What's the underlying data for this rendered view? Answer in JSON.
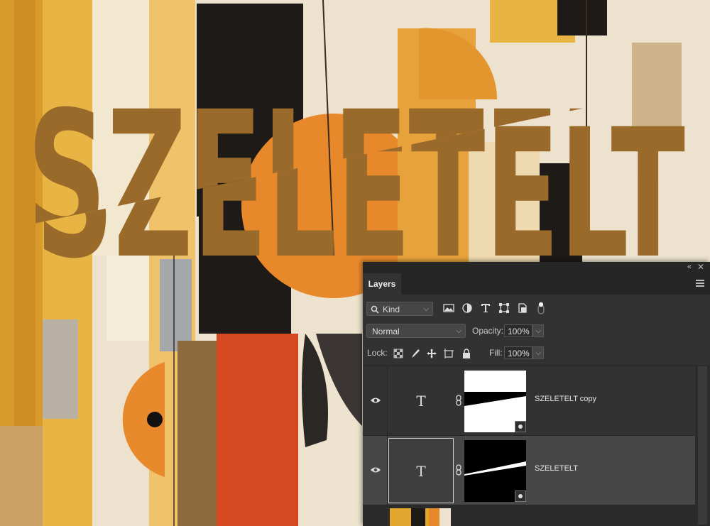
{
  "canvas": {
    "headline_text": "SZELETELT",
    "text_color": "#9a6a2a",
    "palette": {
      "cream": "#ece2cd",
      "mustard": "#e2a52e",
      "orange": "#e7892b",
      "red": "#d6481f",
      "black": "#1e1a17",
      "grey": "#9b9c9d"
    }
  },
  "panel": {
    "tab_label": "Layers",
    "collapse_icon": "«",
    "close_icon": "✕",
    "filter": {
      "kind_label": "Kind",
      "icons": [
        "image-filter-icon",
        "adjustment-filter-icon",
        "type-filter-icon",
        "shape-filter-icon",
        "smart-object-filter-icon",
        "filter-toggle-icon"
      ]
    },
    "blend_mode": "Normal",
    "opacity_label": "Opacity:",
    "opacity_value": "100%",
    "lock_label": "Lock:",
    "fill_label": "Fill:",
    "fill_value": "100%",
    "layers": [
      {
        "name": "SZELETELT copy",
        "type_glyph": "T",
        "selected": false,
        "mask": "white-top"
      },
      {
        "name": "SZELETELT",
        "type_glyph": "T",
        "selected": true,
        "mask": "black-sliver"
      }
    ],
    "chevron": "⌵"
  }
}
